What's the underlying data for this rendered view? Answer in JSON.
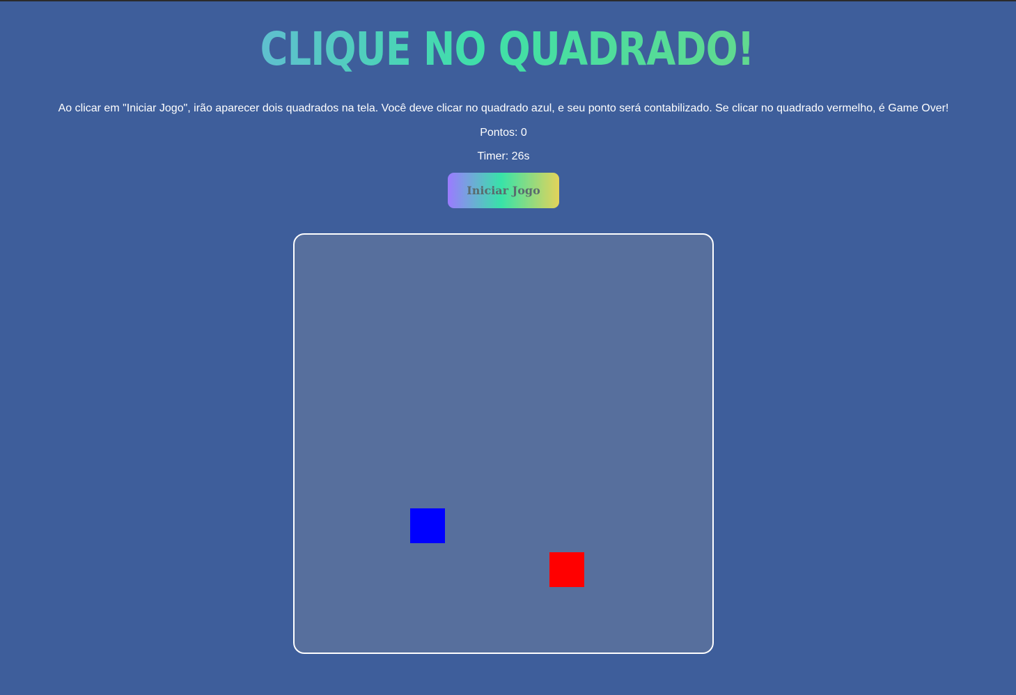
{
  "header": {
    "title": "CLIQUE NO QUADRADO!"
  },
  "instructions": {
    "text": "Ao clicar em \"Iniciar Jogo\", irão aparecer dois quadrados na tela. Você deve clicar no quadrado azul, e seu ponto será contabilizado. Se clicar no quadrado vermelho, é Game Over!"
  },
  "status": {
    "score_text": "Pontos: 0",
    "timer_text": "Timer: 26s"
  },
  "controls": {
    "start_label": "Iniciar Jogo"
  },
  "board": {
    "squares": [
      {
        "color_name": "blue",
        "color": "#0000ff"
      },
      {
        "color_name": "red",
        "color": "#ff0000"
      }
    ]
  },
  "colors": {
    "background": "#3e5e9b",
    "board": "#576f9d",
    "title_gradient": [
      "#5fbfcf",
      "#3fe0a8",
      "#62d98f"
    ],
    "button_gradient": [
      "#9b7bff",
      "#38e3a8",
      "#e3d35a"
    ]
  }
}
